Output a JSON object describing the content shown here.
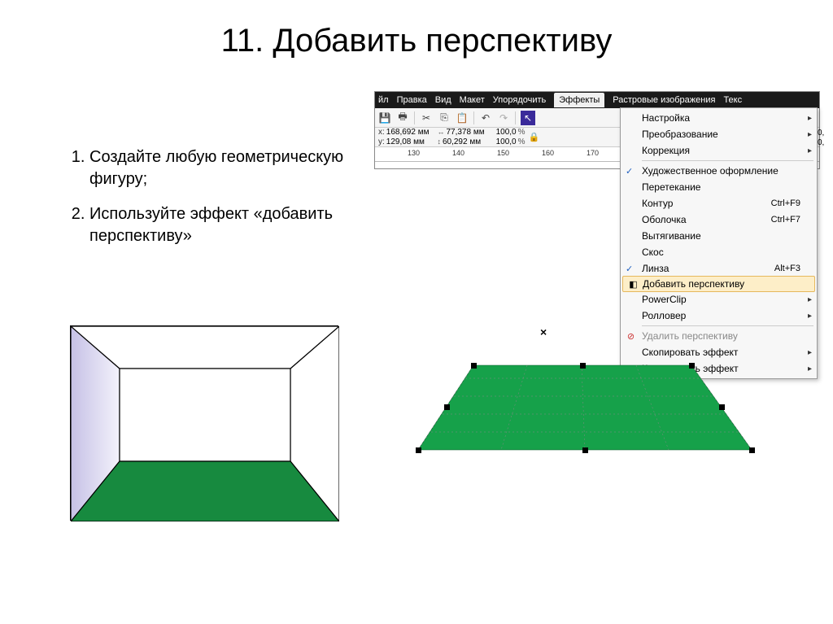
{
  "slide": {
    "title": "11. Добавить перспективу"
  },
  "instructions": {
    "item1": "Создайте любую геометрическую фигуру;",
    "item2": "Используйте эффект «добавить перспективу»"
  },
  "menubar": {
    "file": "йл",
    "edit": "Правка",
    "view": "Вид",
    "layout": "Макет",
    "arrange": "Упорядочить",
    "effects": "Эффекты",
    "bitmaps": "Растровые изображения",
    "text": "Текс"
  },
  "propbar": {
    "x": "168,692 мм",
    "y": "129,08 мм",
    "w": "77,378 мм",
    "h": "60,292 мм",
    "sx": "100,0",
    "sy": "100,0",
    "pct": "%",
    "extra": "0,"
  },
  "ruler": {
    "t1": "130",
    "t2": "140",
    "t3": "150",
    "t4": "160",
    "t5": "170"
  },
  "menu": {
    "adjust": "Настройка",
    "transform": "Преобразование",
    "correction": "Коррекция",
    "artmedia": "Художественное оформление",
    "blend": "Перетекание",
    "contour": "Контур",
    "contour_sc": "Ctrl+F9",
    "envelope": "Оболочка",
    "envelope_sc": "Ctrl+F7",
    "extrude": "Вытягивание",
    "bevel": "Скос",
    "lens": "Линза",
    "lens_sc": "Alt+F3",
    "add_persp": "Добавить перспективу",
    "powerclip": "PowerClip",
    "rollover": "Ролловер",
    "clear_persp": "Удалить перспективу",
    "copy_eff": "Скопировать эффект",
    "clone_eff": "Клонировать эффект"
  },
  "canvas": {
    "x_mark": "×"
  },
  "colors": {
    "green": "#178a3f",
    "green2": "#16a14a",
    "lilac": "#d7d4ee"
  }
}
